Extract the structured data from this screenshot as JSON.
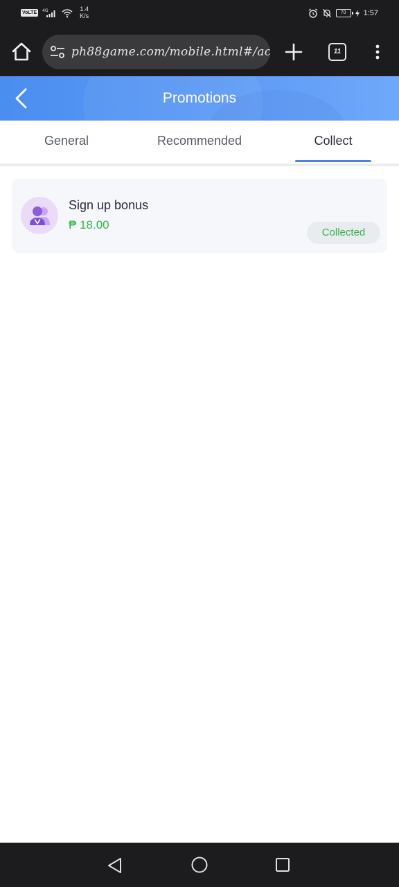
{
  "status_bar": {
    "volte": "VoLTE",
    "network": "4G",
    "speed_value": "1.4",
    "speed_unit": "K/s",
    "battery": "70",
    "time": "1:57"
  },
  "browser": {
    "url": "ph88game.com/mobile.html#/acti",
    "tab_count": "11"
  },
  "header": {
    "title": "Promotions"
  },
  "tabs": [
    {
      "label": "General",
      "active": false
    },
    {
      "label": "Recommended",
      "active": false
    },
    {
      "label": "Collect",
      "active": true
    }
  ],
  "promotions": [
    {
      "title": "Sign up bonus",
      "amount": "₱ 18.00",
      "status": "Collected"
    }
  ],
  "colors": {
    "header_gradient_start": "#4a8ef0",
    "header_gradient_end": "#6ea8fa",
    "active_tab_underline": "#4a86e0",
    "amount_green": "#2fb84a",
    "badge_bg": "#e9ecef"
  }
}
